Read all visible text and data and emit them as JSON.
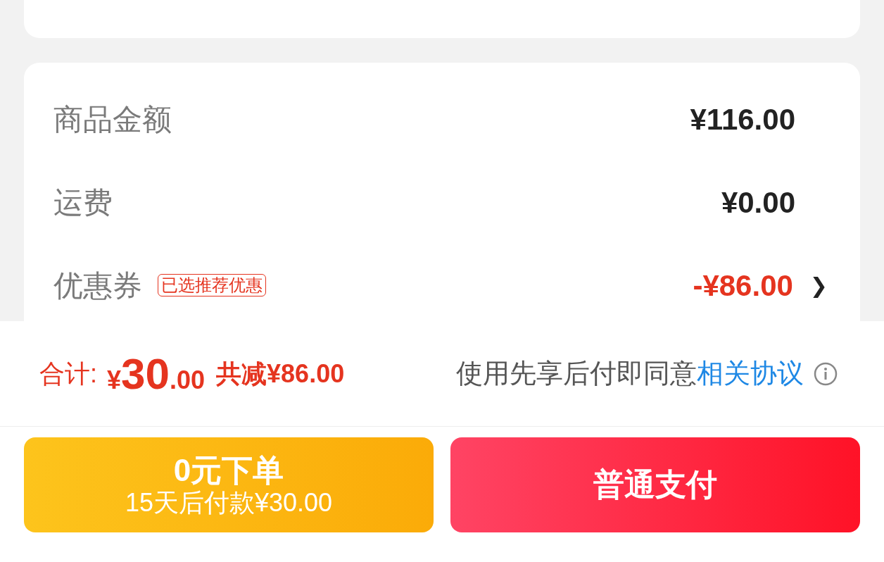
{
  "summary_rows": [
    {
      "kind": "plain",
      "label": "商品金额",
      "value": "¥116.00"
    },
    {
      "kind": "plain",
      "label": "运费",
      "value": "¥0.00"
    },
    {
      "kind": "coupon",
      "label": "优惠券",
      "tag": "已选推荐优惠",
      "value": "-¥86.00",
      "chevron": "❯"
    }
  ],
  "total": {
    "label": "合计:",
    "currency": "¥",
    "integer": "30",
    "decimal": ".00",
    "saving": "共减¥86.00"
  },
  "agreement": {
    "text": "使用先享后付即同意",
    "link": "相关协议"
  },
  "buttons": [
    {
      "kind": "later",
      "title": "0元下单",
      "subtitle": "15天后付款¥30.00"
    },
    {
      "kind": "normal",
      "title": "普通支付"
    }
  ]
}
